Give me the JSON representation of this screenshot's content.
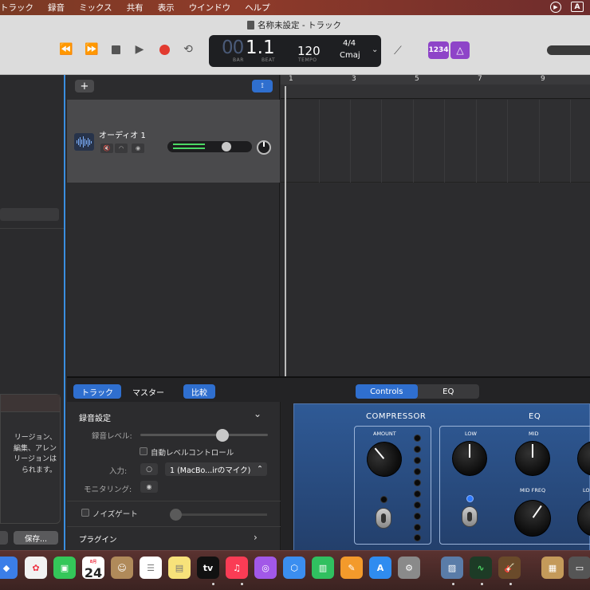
{
  "menubar": {
    "items": [
      "トラック",
      "録音",
      "ミックス",
      "共有",
      "表示",
      "ウインドウ",
      "ヘルプ"
    ],
    "right_icons": [
      "play-circle-icon",
      "input-source-icon"
    ],
    "input_source_label": "A"
  },
  "window": {
    "title": "名称未設定 - トラック"
  },
  "transport": {
    "bar": "00",
    "beat": "1.1",
    "bar_label": "BAR",
    "beat_label": "BEAT",
    "tempo": "120",
    "tempo_label": "TEMPO",
    "time_signature": "4/4",
    "key": "Cmaj",
    "count_in": "1234"
  },
  "tracks_header": {
    "add_label": "+"
  },
  "track": {
    "name": "オーディオ 1"
  },
  "ruler": {
    "numbers": [
      "1",
      "3",
      "5",
      "7",
      "9"
    ]
  },
  "library": {
    "dialog_text": "リージョン、\n編集、アレン\nリージョンは\nられます。",
    "save_label": "保存..."
  },
  "editor": {
    "tabs_left": [
      "トラック",
      "マスター",
      "比較"
    ],
    "tabs_right": [
      "Controls",
      "EQ"
    ],
    "record_settings": "録音設定",
    "record_level": "録音レベル:",
    "auto_level": "自動レベルコントロール",
    "input_label": "入力:",
    "input_value": "1 (MacBo...irのマイク)",
    "monitoring": "モニタリング:",
    "noise_gate": "ノイズゲート",
    "plugins": "プラグイン"
  },
  "plugin": {
    "compressor": "COMPRESSOR",
    "amount": "AMOUNT",
    "eq": "EQ",
    "low": "LOW",
    "mid": "MID",
    "mid_freq": "MID FREQ",
    "lo_partial": "LO"
  },
  "dock": {
    "calendar_month": "8月",
    "calendar_day": "24",
    "tv_label": "tv"
  },
  "colors": {
    "accent": "#2f6fcf",
    "record": "#e23b30",
    "purple": "#8e44c8",
    "meter": "#4cd964"
  }
}
